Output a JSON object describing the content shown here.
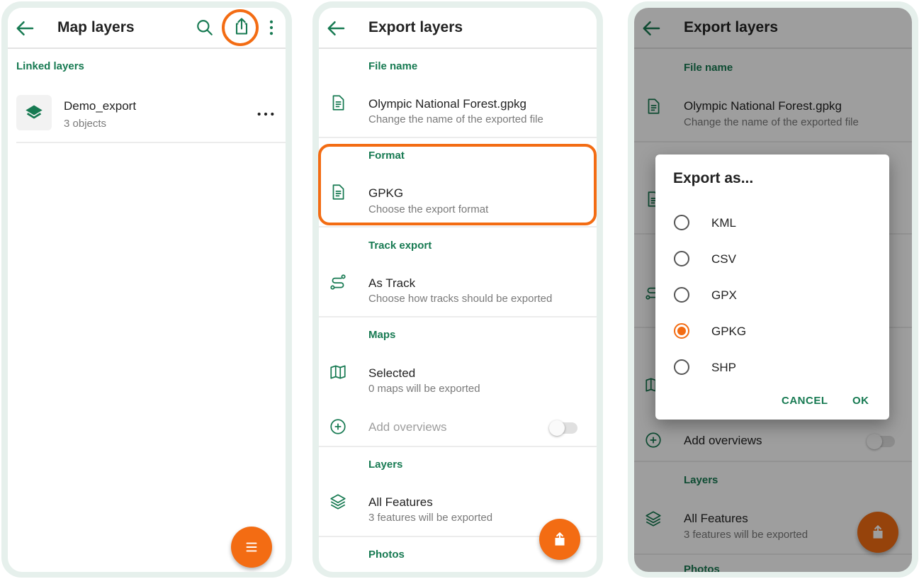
{
  "colors": {
    "accent_orange": "#f36c13",
    "brand_green": "#177a52",
    "frame": "#e6f0ec"
  },
  "screen1": {
    "title": "Map layers",
    "icons": [
      "back-arrow-icon",
      "search-icon",
      "share-export-icon",
      "more-vert-icon"
    ],
    "section": "Linked layers",
    "layer": {
      "name": "Demo_export",
      "count": "3 objects"
    }
  },
  "screen2": {
    "title": "Export layers",
    "file_name": {
      "section": "File name",
      "title": "Olympic National Forest.gpkg",
      "sub": "Change the name of the exported file"
    },
    "format": {
      "section": "Format",
      "title": "GPKG",
      "sub": "Choose the export format"
    },
    "track": {
      "section": "Track export",
      "title": "As Track",
      "sub": "Choose how tracks should be exported"
    },
    "maps": {
      "section": "Maps",
      "title": "Selected",
      "sub": "0 maps will be exported",
      "overviews": "Add overviews"
    },
    "layers": {
      "section": "Layers",
      "title": "All Features",
      "sub": "3 features will be exported"
    },
    "photos": {
      "section": "Photos"
    }
  },
  "screen3": {
    "title": "Export layers",
    "file_name": {
      "section": "File name",
      "title": "Olympic National Forest.gpkg",
      "sub": "Change the name of the exported file"
    },
    "overviews": "Add overviews",
    "layers": {
      "section": "Layers",
      "title": "All Features",
      "sub": "3 features will be exported"
    },
    "photos_partial": "Photos",
    "dialog": {
      "title": "Export as...",
      "options": [
        "KML",
        "CSV",
        "GPX",
        "GPKG",
        "SHP"
      ],
      "selected": "GPKG",
      "cancel": "CANCEL",
      "ok": "OK"
    }
  }
}
